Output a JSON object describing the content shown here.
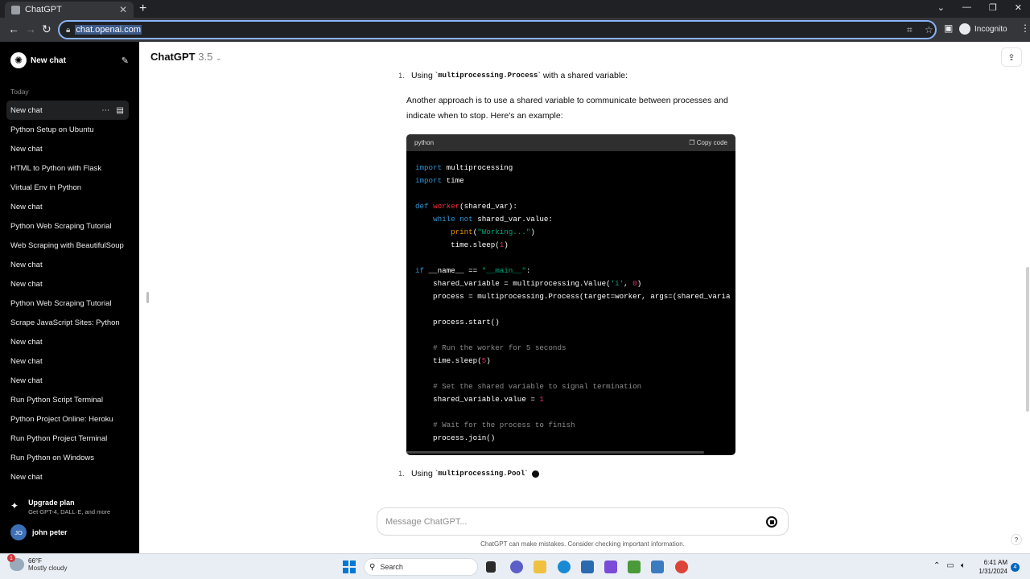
{
  "browser": {
    "tab_title": "ChatGPT",
    "url": "chat.openai.com",
    "incognito_label": "Incognito"
  },
  "sidebar": {
    "new_chat_label": "New chat",
    "section_today": "Today",
    "history": [
      "New chat",
      "Python Setup on Ubuntu",
      "New chat",
      "HTML to Python with Flask",
      "Virtual Env in Python",
      "New chat",
      "Python Web Scraping Tutorial",
      "Web Scraping with BeautifulSoup",
      "New chat",
      "New chat",
      "Python Web Scraping Tutorial",
      "Scrape JavaScript Sites: Python",
      "New chat",
      "New chat",
      "New chat",
      "Run Python Script Terminal",
      "Python Project Online: Heroku",
      "Run Python Project Terminal",
      "Run Python on Windows",
      "New chat"
    ],
    "upgrade_title": "Upgrade plan",
    "upgrade_sub": "Get GPT-4, DALL·E, and more",
    "user_initials": "JO",
    "user_name": "john peter"
  },
  "header": {
    "model_name": "ChatGPT",
    "model_version": "3.5"
  },
  "message": {
    "item1_num": "1.",
    "item1_prefix": "Using `",
    "item1_code": "multiprocessing.Process",
    "item1_suffix": "` with a shared variable:",
    "paragraph": "Another approach is to use a shared variable to communicate between processes and indicate when to stop. Here's an example:",
    "code_lang": "python",
    "copy_label": "Copy code",
    "item2_num": "1.",
    "item2_prefix": "Using `",
    "item2_code": "multiprocessing.Pool",
    "item2_suffix": "`"
  },
  "code_lines": [
    "import multiprocessing",
    "import time",
    "",
    "def worker(shared_var):",
    "    while not shared_var.value:",
    "        print(\"Working...\")",
    "        time.sleep(1)",
    "",
    "if __name__ == \"__main__\":",
    "    shared_variable = multiprocessing.Value('i', 0)",
    "    process = multiprocessing.Process(target=worker, args=(shared_varia",
    "",
    "    process.start()",
    "",
    "    # Run the worker for 5 seconds",
    "    time.sleep(5)",
    "",
    "    # Set the shared variable to signal termination",
    "    shared_variable.value = 1",
    "",
    "    # Wait for the process to finish",
    "    process.join()"
  ],
  "composer": {
    "placeholder": "Message ChatGPT...",
    "disclaimer": "ChatGPT can make mistakes. Consider checking important information."
  },
  "taskbar": {
    "weather_temp": "66°F",
    "weather_desc": "Mostly cloudy",
    "weather_badge": "1",
    "search_label": "Search",
    "time": "6:41 AM",
    "date": "1/31/2024",
    "notification_count": "4"
  },
  "colors": {
    "sidebar_bg": "#000000",
    "accent": "#8ab4f8",
    "keyword": "#2e95d3",
    "function": "#f22c3d",
    "string": "#00a67d",
    "number": "#df3079"
  }
}
